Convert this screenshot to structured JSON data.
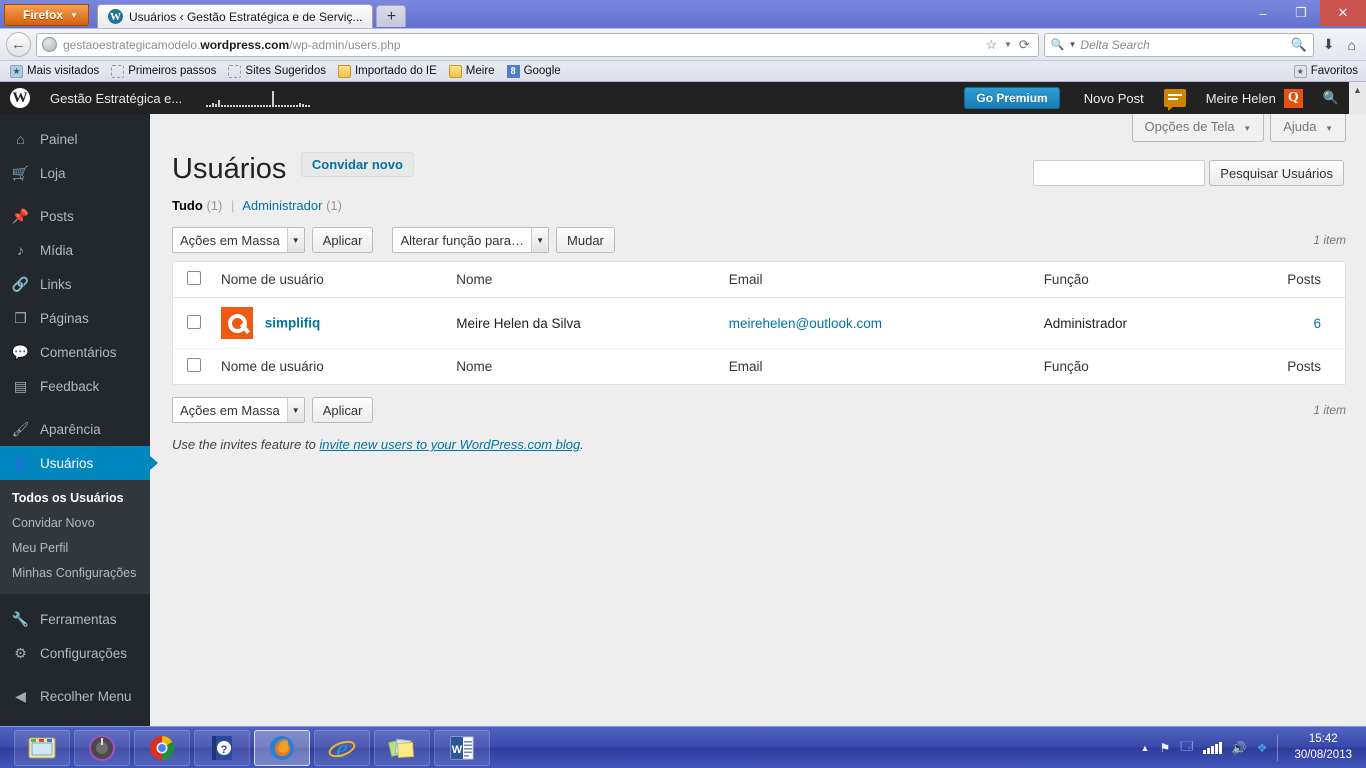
{
  "browser": {
    "firefox_button": "Firefox",
    "tab_title": "Usuários ‹ Gestão Estratégica e de Serviç...",
    "newtab_label": "+",
    "url_prefix": "gestaoestrategicamodelo.",
    "url_domain": "wordpress.com",
    "url_path": "/wp-admin/users.php",
    "search_placeholder": "Delta Search",
    "window_minimize": "–",
    "window_restore": "❐",
    "window_close": "✕",
    "bookmarks": [
      {
        "label": "Mais visitados",
        "icon": "star-bookmark-icon"
      },
      {
        "label": "Primeiros passos",
        "icon": "dashed-placeholder-icon"
      },
      {
        "label": "Sites Sugeridos",
        "icon": "dashed-placeholder-icon"
      },
      {
        "label": "Importado do IE",
        "icon": "folder-icon"
      },
      {
        "label": "Meire",
        "icon": "folder-icon"
      },
      {
        "label": "Google",
        "icon": "google-icon"
      }
    ],
    "favorites_label": "Favoritos"
  },
  "adminbar": {
    "logo": "wordpress-logo-icon",
    "site_name": "Gestão Estratégica e...",
    "go_premium": "Go Premium",
    "new_post": "Novo Post",
    "comments_icon": "comment-bubble-icon",
    "user_name": "Meire Helen",
    "user_avatar": "simplifiq-avatar-icon",
    "search_icon": "search-icon"
  },
  "sidebar": {
    "items": [
      {
        "label": "Painel",
        "icon": "dashboard-home-icon",
        "active": false
      },
      {
        "label": "Loja",
        "icon": "cart-icon",
        "active": false
      },
      {
        "label": "Posts",
        "icon": "pin-icon",
        "active": false
      },
      {
        "label": "Mídia",
        "icon": "media-icon",
        "active": false
      },
      {
        "label": "Links",
        "icon": "link-icon",
        "active": false
      },
      {
        "label": "Páginas",
        "icon": "pages-icon",
        "active": false
      },
      {
        "label": "Comentários",
        "icon": "comment-icon",
        "active": false
      },
      {
        "label": "Feedback",
        "icon": "feedback-icon",
        "active": false
      },
      {
        "label": "Aparência",
        "icon": "brush-icon",
        "active": false
      },
      {
        "label": "Usuários",
        "icon": "user-icon",
        "active": true
      }
    ],
    "submenu": [
      {
        "label": "Todos os Usuários",
        "current": true
      },
      {
        "label": "Convidar Novo",
        "current": false
      },
      {
        "label": "Meu Perfil",
        "current": false
      },
      {
        "label": "Minhas Configurações",
        "current": false
      }
    ],
    "items_after": [
      {
        "label": "Ferramentas",
        "icon": "wrench-icon"
      },
      {
        "label": "Configurações",
        "icon": "settings-icon"
      }
    ],
    "collapse_label": "Recolher Menu"
  },
  "screen_meta": {
    "screen_options": "Opções de Tela",
    "help": "Ajuda",
    "caret": "▼"
  },
  "page": {
    "title": "Usuários",
    "add_new": "Convidar novo",
    "filters": [
      {
        "label": "Tudo",
        "count": "(1)",
        "current": true
      },
      {
        "label": "Administrador",
        "count": "(1)",
        "current": false
      }
    ],
    "filter_separator": "|",
    "search_value": "",
    "search_button": "Pesquisar Usuários",
    "item_count": "1 item",
    "bulk_actions_label": "Ações em Massa",
    "apply_label": "Aplicar",
    "change_role_label": "Alterar função para…",
    "change_label": "Mudar",
    "columns": [
      "Nome de usuário",
      "Nome",
      "Email",
      "Função",
      "Posts"
    ],
    "rows": [
      {
        "username": "simplifiq",
        "avatar": "simplifiq-avatar-icon",
        "name": "Meire Helen da Silva",
        "email": "meirehelen@outlook.com",
        "role": "Administrador",
        "posts": "6"
      }
    ],
    "invites_text": "Use the invites feature to ",
    "invites_link": "invite new users to your WordPress.com blog",
    "invites_period": "."
  },
  "taskbar": {
    "items": [
      {
        "name": "file-explorer-icon",
        "active": false
      },
      {
        "name": "media-player-icon",
        "active": false
      },
      {
        "name": "chrome-icon",
        "active": false
      },
      {
        "name": "help-icon",
        "active": false
      },
      {
        "name": "firefox-icon",
        "active": true
      },
      {
        "name": "internet-explorer-icon",
        "active": false
      },
      {
        "name": "sticky-notes-icon",
        "active": false
      },
      {
        "name": "word-icon",
        "active": false
      }
    ],
    "tray": {
      "show_hidden": "▲",
      "flag_icon": "flag-icon",
      "action-center": "action-center-icon",
      "network_icon": "network-signal-icon",
      "volume_icon": "volume-icon",
      "dropbox_icon": "dropbox-icon"
    },
    "time": "15:42",
    "date": "30/08/2013"
  },
  "colors": {
    "accent": "#0087be",
    "link": "#0074a2",
    "avatar_orange": "#ee5a10",
    "admin_dark": "#23282d",
    "premium_blue": "#1a7cb5"
  }
}
